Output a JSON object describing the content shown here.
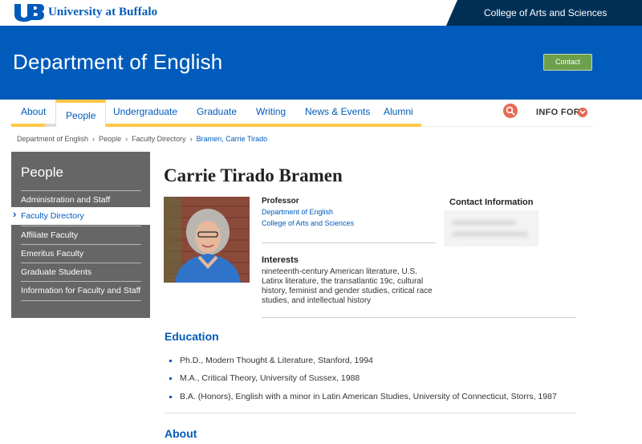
{
  "header": {
    "university": "University at Buffalo",
    "college": "College of Arts and Sciences",
    "department": "Department of English",
    "contact_label": "Contact"
  },
  "nav": {
    "items": [
      "About",
      "People",
      "Undergraduate",
      "Graduate",
      "Writing",
      "News & Events",
      "Alumni"
    ],
    "active": "People",
    "info_for": "INFO FOR"
  },
  "breadcrumb": [
    "Department of English",
    "People",
    "Faculty Directory",
    "Bramen, Carrie Tirado"
  ],
  "sidebar": {
    "title": "People",
    "items": [
      {
        "label": "Administration and Staff"
      },
      {
        "label": "Faculty Directory",
        "active": true
      },
      {
        "label": "Affiliate Faculty"
      },
      {
        "label": "Emeritus Faculty"
      },
      {
        "label": "Graduate Students"
      },
      {
        "label": "Information for Faculty and Staff"
      }
    ]
  },
  "profile": {
    "name": "Carrie Tirado Bramen",
    "title": "Professor",
    "affiliations": [
      "Department of English",
      "College of Arts and Sciences"
    ],
    "interests_heading": "Interests",
    "interests": "nineteenth-century American literature, U.S. Latinx literature, the transatlantic 19c, cultural history, feminist and gender studies, critical race studies, and intellectual history",
    "contact_heading": "Contact Information"
  },
  "education": {
    "heading": "Education",
    "items": [
      "Ph.D., Modern Thought & Literature, Stanford, 1994",
      "M.A., Critical Theory, University of Sussex, 1988",
      "B.A. (Honors), English with a minor in Latin American Studies, University of Connecticut, Storrs, 1987"
    ]
  },
  "about": {
    "heading": "About"
  },
  "colors": {
    "ub_blue": "#005bbb",
    "dark_blue": "#002f56",
    "contact_green": "#6da04b",
    "accent_gold": "#ffc845",
    "search_red": "#e56a54",
    "sidebar_gray": "#666666"
  },
  "icons": [
    "ub-logo-icon",
    "search-icon",
    "chevron-down-icon",
    "chevron-right-icon"
  ]
}
